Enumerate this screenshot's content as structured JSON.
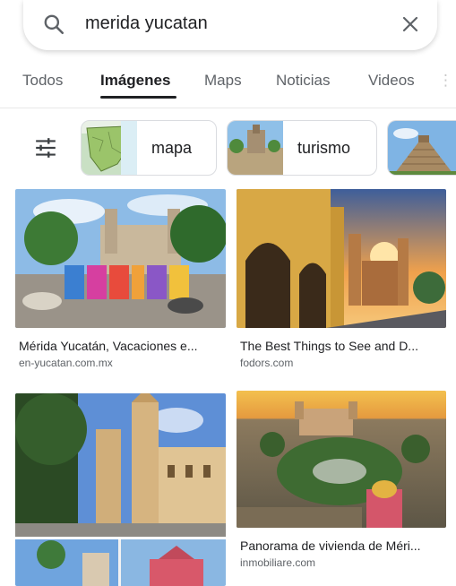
{
  "search": {
    "query": "merida yucatan"
  },
  "tabs": [
    {
      "label": "Todos",
      "active": false
    },
    {
      "label": "Imágenes",
      "active": true
    },
    {
      "label": "Maps",
      "active": false
    },
    {
      "label": "Noticias",
      "active": false
    },
    {
      "label": "Videos",
      "active": false
    }
  ],
  "chips": [
    {
      "label": "mapa",
      "icon": "map-thumbnail"
    },
    {
      "label": "turismo",
      "icon": "tourism-thumbnail"
    },
    {
      "label": "",
      "icon": "pyramid-thumbnail"
    }
  ],
  "results": [
    {
      "title": "Mérida Yucatán, Vacaciones e...",
      "source": "en-yucatan.com.mx"
    },
    {
      "title": "The Best Things to See and D...",
      "source": "fodors.com"
    },
    {
      "title": "",
      "source": ""
    },
    {
      "title": "Panorama de vivienda de Méri...",
      "source": "inmobiliare.com"
    }
  ],
  "colors": {
    "text_primary": "#202124",
    "text_secondary": "#5f6368",
    "divider": "#e8e8e8"
  }
}
